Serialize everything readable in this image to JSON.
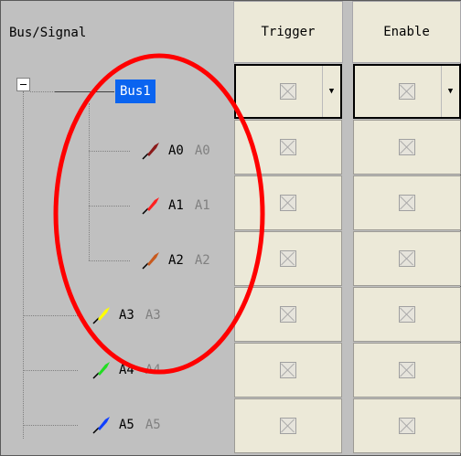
{
  "headers": {
    "bus_signal": "Bus/Signal",
    "trigger": "Trigger",
    "enable": "Enable"
  },
  "bus": {
    "label": "Bus1",
    "expanded": true
  },
  "signals": [
    {
      "name": "A0",
      "alias": "A0",
      "probe_color": "#8b1a1a"
    },
    {
      "name": "A1",
      "alias": "A1",
      "probe_color": "#ff2020"
    },
    {
      "name": "A2",
      "alias": "A2",
      "probe_color": "#c85a1e"
    },
    {
      "name": "A3",
      "alias": "A3",
      "probe_color": "#ffff00"
    },
    {
      "name": "A4",
      "alias": "A4",
      "probe_color": "#22dd22"
    },
    {
      "name": "A5",
      "alias": "A5",
      "probe_color": "#1040ff"
    }
  ],
  "colors": {
    "selection": "#0a64f0",
    "annotation_ellipse": "#ff0000",
    "cell_bg": "#ece9d8",
    "panel_bg": "#c0c0c0"
  }
}
